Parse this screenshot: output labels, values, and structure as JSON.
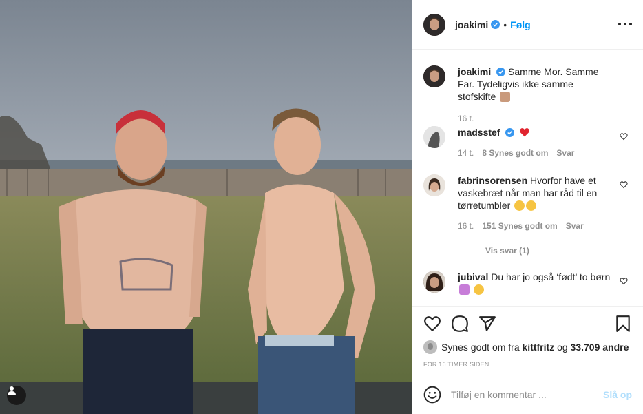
{
  "post": {
    "username": "joakimi",
    "follow_label": "Følg",
    "dot": "•",
    "caption": "Samme Mor. Samme Far. Tydeligvis ikke samme stofskifte",
    "caption_time": "16 t."
  },
  "comments": [
    {
      "user": "madsstef",
      "text": "",
      "time": "14 t.",
      "likes": "8 Synes godt om",
      "reply": "Svar"
    },
    {
      "user": "fabrinsorensen",
      "text": "Hvorfor have et vaskebræt når man har råd til en tørretumbler",
      "time": "16 t.",
      "likes": "151 Synes godt om",
      "reply": "Svar",
      "view_replies": "Vis svar (1)"
    },
    {
      "user": "jubival",
      "text": "Du har jo også ‘født’ to børn"
    }
  ],
  "likes_line": {
    "prefix": "Synes godt om fra",
    "user": "kittfritz",
    "middle": "og",
    "count": "33.709 andre"
  },
  "timestamp": "FOR 16 TIMER SIDEN",
  "add_comment": {
    "placeholder": "Tilføj en kommentar ...",
    "post_label": "Slå op"
  },
  "colors": {
    "accent": "#0095f6",
    "post_disabled": "#b2dffc",
    "muted": "#8e8e8e",
    "text": "#262626"
  },
  "icons": [
    "verified-badge-icon",
    "more-options-icon",
    "heart-icon",
    "comment-icon",
    "share-icon",
    "bookmark-icon",
    "smiley-icon",
    "user-tag-icon"
  ]
}
